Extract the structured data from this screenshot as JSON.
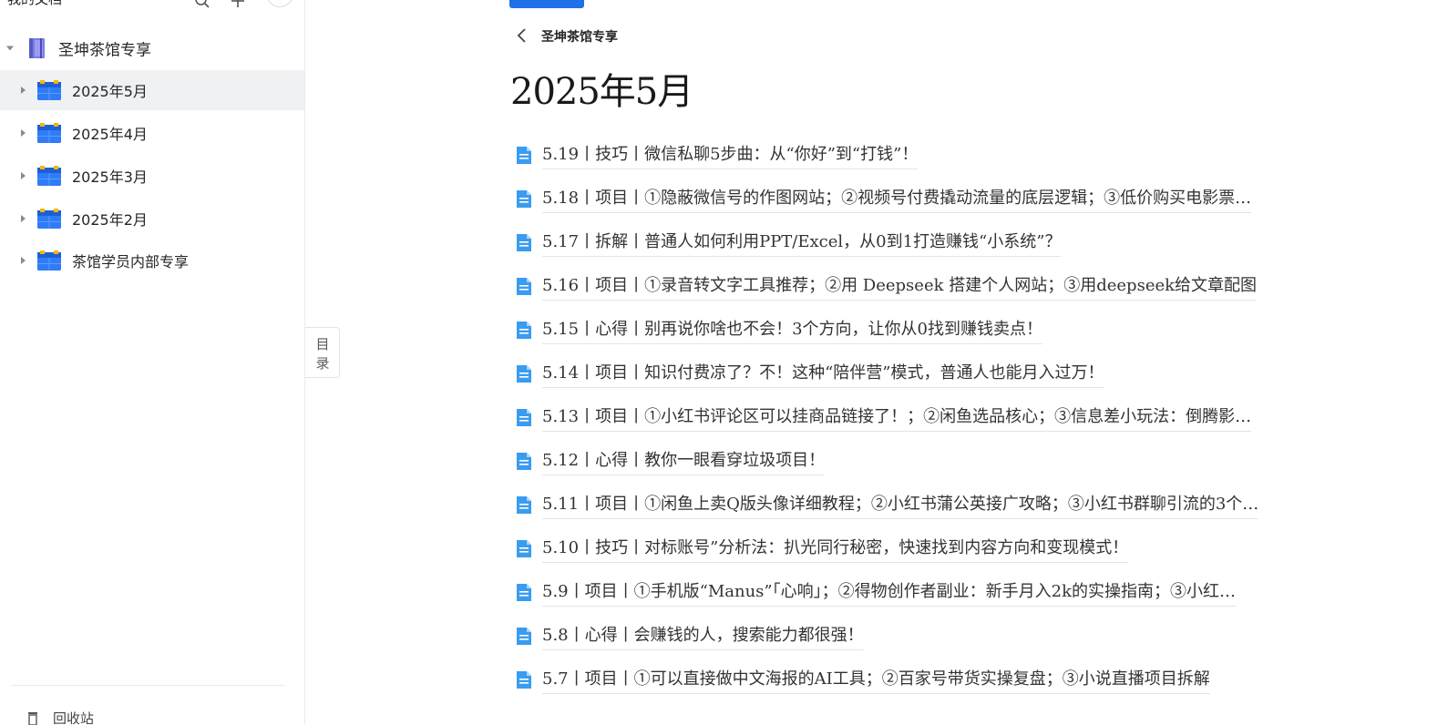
{
  "sidebar": {
    "top_title": "我的文档",
    "root": {
      "label": "圣坤茶馆专享"
    },
    "children": [
      {
        "label": "2025年5月",
        "active": true
      },
      {
        "label": "2025年4月"
      },
      {
        "label": "2025年3月"
      },
      {
        "label": "2025年2月"
      },
      {
        "label": "茶馆学员内部专享"
      }
    ],
    "bottom_text": "回收站"
  },
  "toc_tab": {
    "line1": "目",
    "line2": "录"
  },
  "main": {
    "breadcrumb": "圣坤茶馆专享",
    "title": "2025年5月",
    "docs": [
      "5.19丨技巧丨微信私聊5步曲：从“你好”到“打钱”！",
      "5.18丨项目丨①隐蔽微信号的作图网站；②视频号付费撬动流量的底层逻辑；③低价购买电影票…",
      "5.17丨拆解丨普通人如何利用PPT/Excel，从0到1打造赚钱“小系统”？",
      "5.16丨项目丨①录音转文字工具推荐；②用 Deepseek 搭建个人网站；③用deepseek给文章配图",
      "5.15丨心得丨别再说你啥也不会！3个方向，让你从0找到赚钱卖点！",
      "5.14丨项目丨知识付费凉了？不！这种“陪伴营”模式，普通人也能月入过万！",
      "5.13丨项目丨①小红书评论区可以挂商品链接了！；②闲鱼选品核心；③信息差小玩法：倒腾影…",
      "5.12丨心得丨教你一眼看穿垃圾项目！",
      "5.11丨项目丨①闲鱼上卖Q版头像详细教程；②小红书蒲公英接广攻略；③小红书群聊引流的3个…",
      "5.10丨技巧丨对标账号”分析法：扒光同行秘密，快速找到内容方向和变现模式！",
      "5.9丨项目丨①手机版“Manus”「心响」；②得物创作者副业：新手月入2k的实操指南；③小红…",
      "5.8丨心得丨会赚钱的人，搜索能力都很强！",
      "5.7丨项目丨①可以直接做中文海报的AI工具；②百家号带货实操复盘；③小说直播项目拆解"
    ]
  },
  "colors": {
    "accent": "#1f6fe8",
    "folder_blue": "#2f7cf6",
    "doc_icon_blue": "#3a9cf0",
    "book_purple": "#6f6fdc",
    "active_row_bg": "#f0f1f3"
  }
}
